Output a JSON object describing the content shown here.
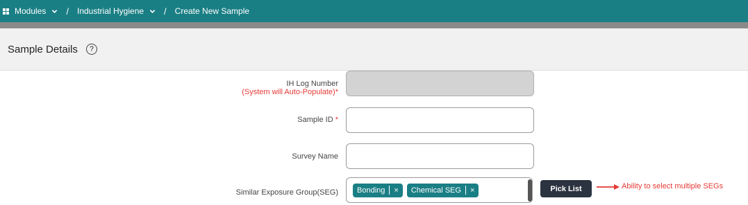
{
  "breadcrumb": {
    "modules": "Modules",
    "module": "Industrial Hygiene",
    "current": "Create New Sample",
    "separator": "/"
  },
  "section": {
    "title": "Sample Details",
    "help": "?"
  },
  "fields": {
    "ih_log": {
      "label": "IH Log Number",
      "hint": "(System will Auto-Populate)",
      "required": "*",
      "value": ""
    },
    "sample_id": {
      "label": "Sample ID",
      "required": "*",
      "value": ""
    },
    "survey_name": {
      "label": "Survey Name",
      "value": ""
    },
    "seg": {
      "label": "Similar Exposure Group(SEG)",
      "chips": [
        "Bonding",
        "Chemical SEG"
      ],
      "remove": "×"
    }
  },
  "pick_list": "Pick List",
  "annotation": "Ability to select multiple SEGs",
  "colors": {
    "header": "#1a7f85",
    "chip": "#1a7f85",
    "button": "#2b3340",
    "required": "#e53935"
  }
}
